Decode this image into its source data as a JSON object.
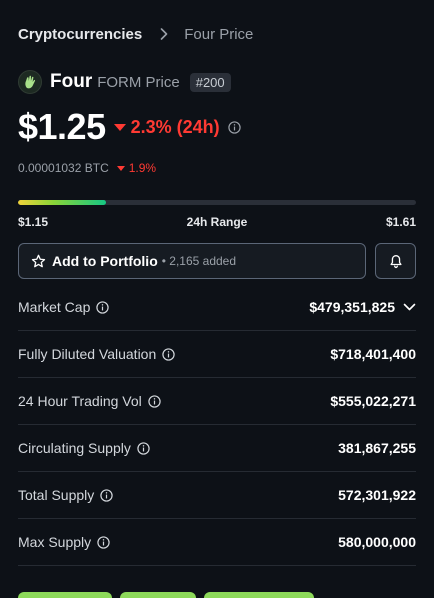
{
  "breadcrumb": {
    "items": [
      "Cryptocurrencies",
      "Four Price"
    ]
  },
  "coin": {
    "name": "Four",
    "symbol_label": "FORM Price",
    "rank": "#200"
  },
  "price": {
    "value": "$1.25",
    "change_24h": "2.3% (24h)",
    "btc_value": "0.00001032 BTC",
    "btc_change": "1.9%"
  },
  "range": {
    "low": "$1.15",
    "label": "24h Range",
    "high": "$1.61",
    "position_fraction": 0.22
  },
  "actions": {
    "portfolio_label": "Add to Portfolio",
    "portfolio_added": "• 2,165 added"
  },
  "stats": [
    {
      "label": "Market Cap",
      "value": "$479,351,825"
    },
    {
      "label": "Fully Diluted Valuation",
      "value": "$718,401,400"
    },
    {
      "label": "24 Hour Trading Vol",
      "value": "$555,022,271"
    },
    {
      "label": "Circulating Supply",
      "value": "381,867,255"
    },
    {
      "label": "Total Supply",
      "value": "572,301,922"
    },
    {
      "label": "Max Supply",
      "value": "580,000,000"
    }
  ],
  "colors": {
    "background": "#0d1117",
    "negative": "#ff3a33",
    "positive_button": "#8dd95a"
  },
  "icons": {
    "info": "info-icon",
    "star": "star-icon",
    "bell": "bell-icon",
    "chevron": "chevron-down-icon",
    "separator": "chevron-right-icon"
  }
}
